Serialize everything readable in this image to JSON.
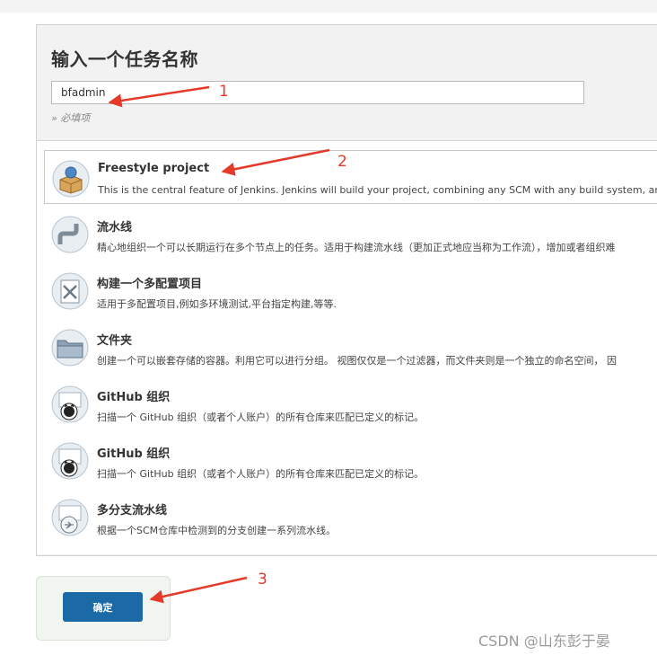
{
  "form": {
    "title": "输入一个任务名称",
    "name_value": "bfadmin",
    "required_hint": "» 必填项"
  },
  "items": [
    {
      "title": "Freestyle project",
      "desc": "This is the central feature of Jenkins. Jenkins will build your project, combining any SCM with any build system, and this",
      "icon": "freestyle-project-icon",
      "selected": true
    },
    {
      "title": "流水线",
      "desc": "精心地组织一个可以长期运行在多个节点上的任务。适用于构建流水线（更加正式地应当称为工作流），增加或者组织难",
      "icon": "pipeline-icon"
    },
    {
      "title": "构建一个多配置项目",
      "desc": "适用于多配置项目,例如多环境测试,平台指定构建,等等.",
      "icon": "multi-config-icon"
    },
    {
      "title": "文件夹",
      "desc": "创建一个可以嵌套存储的容器。利用它可以进行分组。 视图仅仅是一个过滤器，而文件夹则是一个独立的命名空间， 因",
      "icon": "folder-icon"
    },
    {
      "title": "GitHub 组织",
      "desc": "扫描一个 GitHub 组织（或者个人账户）的所有仓库来匹配已定义的标记。",
      "icon": "github-org-icon"
    },
    {
      "title": "GitHub 组织",
      "desc": "扫描一个 GitHub 组织（或者个人账户）的所有仓库来匹配已定义的标记。",
      "icon": "github-org-icon"
    },
    {
      "title": "多分支流水线",
      "desc": "根据一个SCM仓库中检测到的分支创建一系列流水线。",
      "icon": "multibranch-pipeline-icon"
    }
  ],
  "ok_button": "确定",
  "annotations": [
    "1",
    "2",
    "3"
  ],
  "watermark": "CSDN @山东彭于晏",
  "colors": {
    "accent": "#1b6aa5",
    "annotation": "#e53a2a"
  }
}
